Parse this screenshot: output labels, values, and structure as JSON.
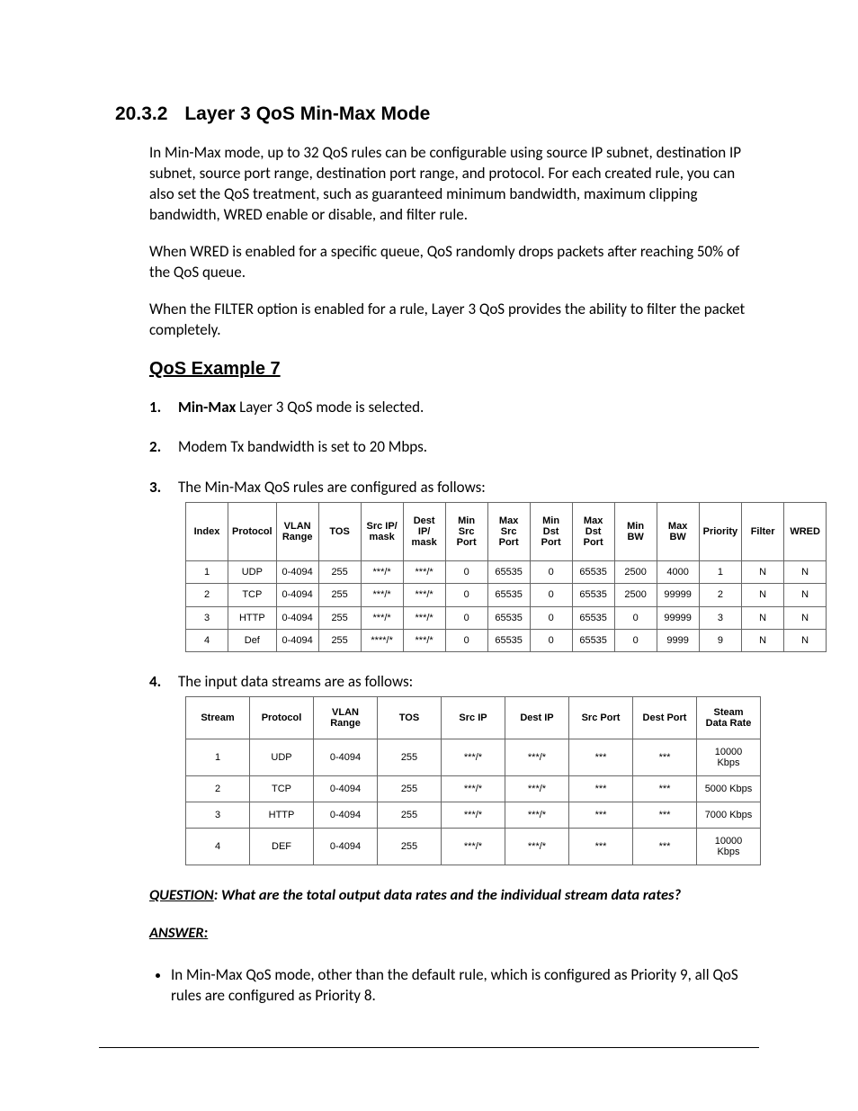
{
  "section": {
    "number": "20.3.2",
    "title": "Layer 3 QoS Min-Max Mode"
  },
  "paragraphs": {
    "p1": "In Min-Max mode, up to 32 QoS rules can be configurable using source IP subnet, destination IP subnet, source port range, destination port range, and protocol. For each created rule, you can also set the QoS treatment, such as guaranteed minimum bandwidth, maximum clipping bandwidth, WRED enable or disable, and filter rule.",
    "p2": "When WRED is enabled for a specific queue, QoS randomly drops packets after reaching 50% of the QoS queue.",
    "p3": "When the FILTER option is enabled for a rule, Layer 3 QoS provides the ability to filter the packet completely."
  },
  "example_heading": "QoS Example 7",
  "steps": {
    "s1_bold": "Min-Max",
    "s1_rest": " Layer 3 QoS mode is selected.",
    "s2": "Modem Tx bandwidth is set to 20 Mbps.",
    "s3": "The Min-Max QoS rules are configured as follows:",
    "s4": "The input data streams are as follows:"
  },
  "table1": {
    "headers": [
      "Index",
      "Protocol",
      "VLAN Range",
      "TOS",
      "Src IP/ mask",
      "Dest IP/ mask",
      "Min Src Port",
      "Max Src Port",
      "Min Dst Port",
      "Max Dst Port",
      "Min BW",
      "Max BW",
      "Priority",
      "Filter",
      "WRED"
    ],
    "rows": [
      [
        "1",
        "UDP",
        "0-4094",
        "255",
        "***/*",
        "***/*",
        "0",
        "65535",
        "0",
        "65535",
        "2500",
        "4000",
        "1",
        "N",
        "N"
      ],
      [
        "2",
        "TCP",
        "0-4094",
        "255",
        "***/*",
        "***/*",
        "0",
        "65535",
        "0",
        "65535",
        "2500",
        "99999",
        "2",
        "N",
        "N"
      ],
      [
        "3",
        "HTTP",
        "0-4094",
        "255",
        "***/*",
        "***/*",
        "0",
        "65535",
        "0",
        "65535",
        "0",
        "99999",
        "3",
        "N",
        "N"
      ],
      [
        "4",
        "Def",
        "0-4094",
        "255",
        "****/*",
        "***/*",
        "0",
        "65535",
        "0",
        "65535",
        "0",
        "9999",
        "9",
        "N",
        "N"
      ]
    ]
  },
  "table2": {
    "headers": [
      "Stream",
      "Protocol",
      "VLAN Range",
      "TOS",
      "Src IP",
      "Dest IP",
      "Src Port",
      "Dest Port",
      "Steam Data Rate"
    ],
    "rows": [
      [
        "1",
        "UDP",
        "0-4094",
        "255",
        "***/*",
        "***/*",
        "***",
        "***",
        "10000 Kbps"
      ],
      [
        "2",
        "TCP",
        "0-4094",
        "255",
        "***/*",
        "***/*",
        "***",
        "***",
        "5000 Kbps"
      ],
      [
        "3",
        "HTTP",
        "0-4094",
        "255",
        "***/*",
        "***/*",
        "***",
        "***",
        "7000 Kbps"
      ],
      [
        "4",
        "DEF",
        "0-4094",
        "255",
        "***/*",
        "***/*",
        "***",
        "***",
        "10000 Kbps"
      ]
    ]
  },
  "question": {
    "label": "QUESTION",
    "text": ": What are the total output data rates and the individual stream data rates?"
  },
  "answer_label": "ANSWER:",
  "answer_bullets": {
    "b1": "In Min-Max QoS mode, other than the default rule, which is configured as Priority 9, all QoS rules are configured as Priority 8."
  }
}
